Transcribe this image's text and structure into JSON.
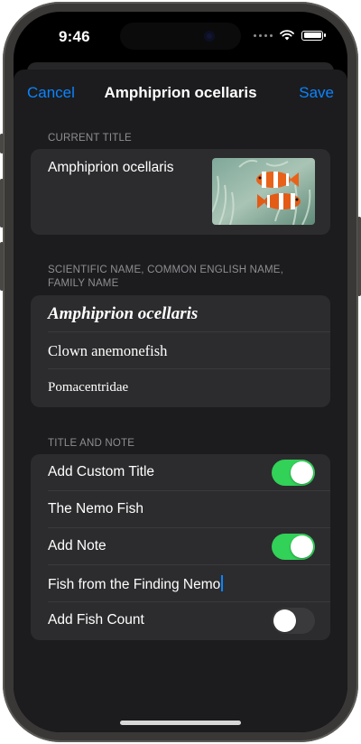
{
  "status_bar": {
    "time": "9:46"
  },
  "nav": {
    "cancel": "Cancel",
    "title": "Amphiprion ocellaris",
    "save": "Save"
  },
  "current_title": {
    "header": "CURRENT TITLE",
    "value": "Amphiprion ocellaris"
  },
  "names": {
    "header": "SCIENTIFIC NAME, COMMON ENGLISH NAME, FAMILY NAME",
    "scientific": "Amphiprion ocellaris",
    "common": "Clown anemonefish",
    "family": "Pomacentridae"
  },
  "title_note": {
    "header": "TITLE AND NOTE",
    "custom_title_label": "Add Custom Title",
    "custom_title_on": true,
    "custom_title_value": "The Nemo Fish",
    "note_label": "Add Note",
    "note_on": true,
    "note_value": "Fish from the Finding Nemo",
    "fish_count_label": "Add Fish Count",
    "fish_count_on": false
  },
  "colors": {
    "accent": "#0a84ff",
    "toggle_on": "#32d158",
    "background": "#1c1c1e",
    "card": "#2c2c2e"
  }
}
